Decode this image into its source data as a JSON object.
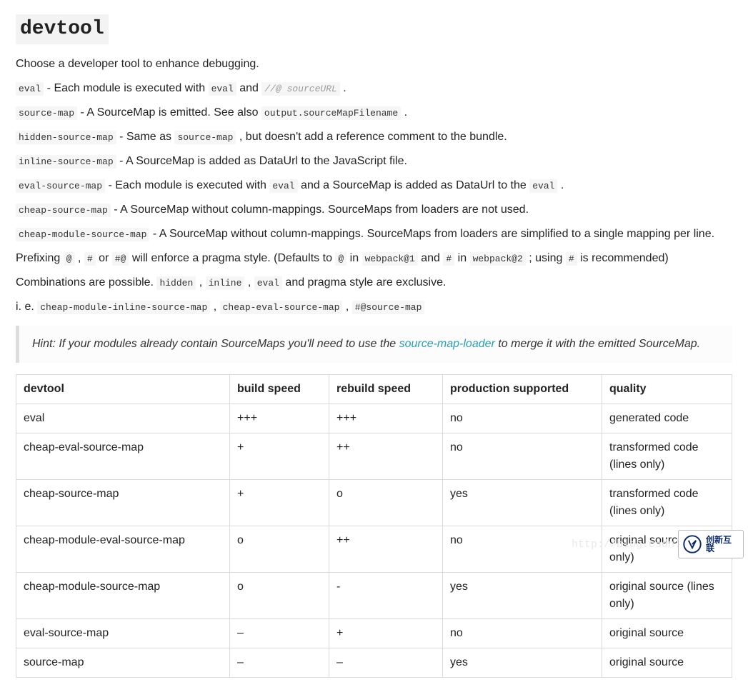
{
  "title": "devtool",
  "intro": "Choose a developer tool to enhance debugging.",
  "lines": {
    "l1a": "eval",
    "l1b": " - Each module is executed with ",
    "l1c": "eval",
    "l1d": " and ",
    "l1e": "//@ sourceURL",
    "l1f": " .",
    "l2a": "source-map",
    "l2b": " - A SourceMap is emitted. See also ",
    "l2c": "output.sourceMapFilename",
    "l2d": " .",
    "l3a": "hidden-source-map",
    "l3b": " - Same as ",
    "l3c": "source-map",
    "l3d": " , but doesn't add a reference comment to the bundle.",
    "l4a": "inline-source-map",
    "l4b": " - A SourceMap is added as DataUrl to the JavaScript file.",
    "l5a": "eval-source-map",
    "l5b": " - Each module is executed with ",
    "l5c": "eval",
    "l5d": " and a SourceMap is added as DataUrl to the ",
    "l5e": "eval",
    "l5f": " .",
    "l6a": "cheap-source-map",
    "l6b": " - A SourceMap without column-mappings. SourceMaps from loaders are not used.",
    "l7a": "cheap-module-source-map",
    "l7b": " - A SourceMap without column-mappings. SourceMaps from loaders are simplified to a single mapping per line.",
    "p1a": "Prefixing ",
    "p1b": "@",
    "p1c": " , ",
    "p1d": "#",
    "p1e": " or ",
    "p1f": "#@",
    "p1g": " will enforce a pragma style. (Defaults to ",
    "p1h": "@",
    "p1i": " in ",
    "p1j": "webpack@",
    "p1jn": "1",
    "p1k": " and ",
    "p1l": "#",
    "p1m": " in ",
    "p1n": "webpack@",
    "p1nn": "2",
    "p1o": " ; using ",
    "p1p": "#",
    "p1q": " is recommended)",
    "c1a": "Combinations are possible. ",
    "c1b": "hidden",
    "c1c": " , ",
    "c1d": "inline",
    "c1e": " , ",
    "c1f": "eval",
    "c1g": " and pragma style are exclusive.",
    "e1a": "i. e. ",
    "e1b": "cheap-module-inline-source-map",
    "e1c": " , ",
    "e1d": "cheap-eval-source-map",
    "e1e": " , ",
    "e1f": "#@source-map"
  },
  "hint": {
    "pre": "Hint: If your modules already contain SourceMaps you'll need to use the ",
    "link": "source-map-loader",
    "post": " to merge it with the emitted SourceMap."
  },
  "table": {
    "headers": [
      "devtool",
      "build speed",
      "rebuild speed",
      "production supported",
      "quality"
    ],
    "rows": [
      [
        "eval",
        "+++",
        "+++",
        "no",
        "generated code"
      ],
      [
        "cheap-eval-source-map",
        "+",
        "++",
        "no",
        "transformed code (lines only)"
      ],
      [
        "cheap-source-map",
        "+",
        "o",
        "yes",
        "transformed code (lines only)"
      ],
      [
        "cheap-module-eval-source-map",
        "o",
        "++",
        "no",
        "original source (lines only)"
      ],
      [
        "cheap-module-source-map",
        "o",
        "-",
        "yes",
        "original source (lines only)"
      ],
      [
        "eval-source-map",
        "–",
        "+",
        "no",
        "original source"
      ],
      [
        "source-map",
        "–",
        "–",
        "yes",
        "original source"
      ]
    ]
  },
  "watermark": "http://blog.csdn.net/li",
  "badge": "创新互联"
}
